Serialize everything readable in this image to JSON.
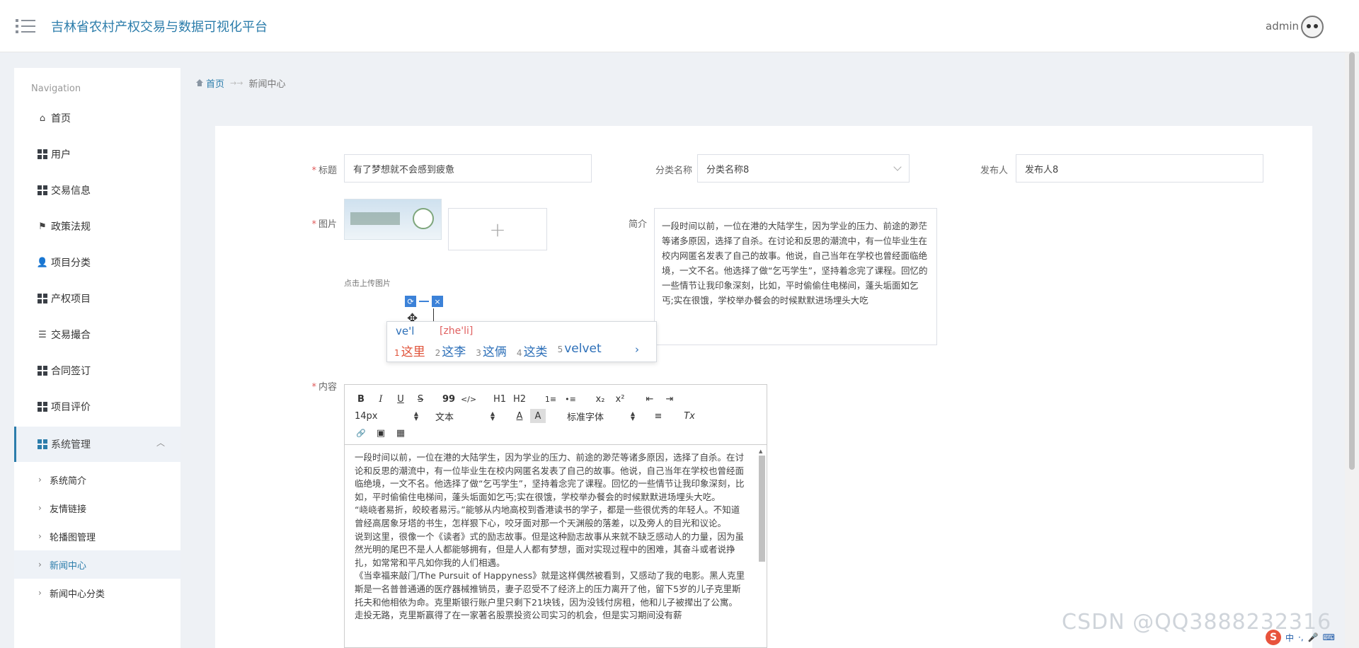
{
  "header": {
    "title": "吉林省农村产权交易与数据可视化平台",
    "user": "admin"
  },
  "sidebar": {
    "heading": "Navigation",
    "items": [
      {
        "label": "首页",
        "icon": "home-icon"
      },
      {
        "label": "用户",
        "icon": "grid-icon"
      },
      {
        "label": "交易信息",
        "icon": "grid-icon"
      },
      {
        "label": "政策法规",
        "icon": "flag-icon"
      },
      {
        "label": "项目分类",
        "icon": "user-icon"
      },
      {
        "label": "产权项目",
        "icon": "grid-icon"
      },
      {
        "label": "交易撮合",
        "icon": "list-icon"
      },
      {
        "label": "合同签订",
        "icon": "grid-icon"
      },
      {
        "label": "项目评价",
        "icon": "grid-icon"
      },
      {
        "label": "系统管理",
        "icon": "grid-icon"
      }
    ],
    "sub_items": [
      {
        "label": "系统简介"
      },
      {
        "label": "友情链接"
      },
      {
        "label": "轮播图管理"
      },
      {
        "label": "新闻中心"
      },
      {
        "label": "新闻中心分类"
      }
    ]
  },
  "breadcrumb": {
    "home": "首页",
    "separator": "→→",
    "current": "新闻中心"
  },
  "form": {
    "title_label": "标题",
    "title_value": "有了梦想就不会感到疲惫",
    "category_label": "分类名称",
    "category_value": "分类名称8",
    "publisher_label": "发布人",
    "publisher_value": "发布人8",
    "image_label": "图片",
    "upload_hint": "点击上传图片",
    "upload_plus": "+",
    "summary_label": "简介",
    "summary_value": "一段时间以前，一位在港的大陆学生，因为学业的压力、前途的渺茫等诸多原因，选择了自杀。在讨论和反思的潮流中，有一位毕业生在校内网匿名发表了自己的故事。他说，自己当年在学校也曾经面临绝境，一文不名。他选择了做“乞丐学生”，坚持着念完了课程。回忆的一些情节让我印象深刻，比如，平时偷偷住电梯间，蓬头垢面如乞丐;实在很饿，学校举办餐会的时候默默进场埋头大吃",
    "content_label": "内容"
  },
  "ime": {
    "refresh": "⟳",
    "close": "×",
    "input": "ve'l",
    "pinyin": "[zhe'li]",
    "candidates": [
      {
        "n": "1",
        "text": "这里"
      },
      {
        "n": "2",
        "text": "这李"
      },
      {
        "n": "3",
        "text": "这俩"
      },
      {
        "n": "4",
        "text": "这类"
      },
      {
        "n": "5",
        "text": "velvet"
      }
    ],
    "next": "›"
  },
  "editor": {
    "toolbar": {
      "bold": "B",
      "italic": "I",
      "underline": "U",
      "strike": "S",
      "quote": "99",
      "code": "</>",
      "h1": "H1",
      "h2": "H2",
      "ol": "1≡",
      "ul": "•≡",
      "sub": "x₂",
      "sup": "x²",
      "outdent": "⇤",
      "indent": "⇥",
      "size": "14px",
      "type": "文本",
      "font": "标准字体",
      "color": "A",
      "bg": "A",
      "align": "≡",
      "clean": "Tx",
      "link": "🔗",
      "image": "▣",
      "video": "▦"
    },
    "paragraphs": [
      "一段时间以前，一位在港的大陆学生，因为学业的压力、前途的渺茫等诸多原因，选择了自杀。在讨论和反思的潮流中，有一位毕业生在校内网匿名发表了自己的故事。他说，自己当年在学校也曾经面临绝境，一文不名。他选择了做“乞丐学生”，坚持着念完了课程。回忆的一些情节让我印象深刻，比如，平时偷偷住电梯间，蓬头垢面如乞丐;实在很饿，学校举办餐会的时候默默进场埋头大吃。",
      "“峣峣者易折，皎皎者易污。”能够从内地高校到香港读书的学子，都是一些很优秀的年轻人。不知道曾经高居象牙塔的书生，怎样狠下心，咬牙面对那一个天渊般的落差，以及旁人的目光和议论。",
      "说到这里，很像一个《读者》式的励志故事。但是这种励志故事从来就不缺乏感动人的力量，因为虽然光明的尾巴不是人人都能够拥有，但是人人都有梦想，面对实现过程中的困难，其奋斗或者说挣扎，如常常和平凡如你我的人们相遇。",
      "《当幸福来敲门/The Pursuit of Happyness》就是这样偶然被看到，又感动了我的电影。黑人克里斯是一名普普通通的医疗器械推销员，妻子忍受不了经济上的压力离开了他，留下5岁的儿子克里斯托夫和他相依为命。克里斯银行账户里只剩下21块钱，因为没钱付房租，他和儿子被撵出了公寓。走投无路，克里斯赢得了在一家著名股票投资公司实习的机会，但是实习期间没有薪"
    ]
  },
  "watermark": "CSDN @QQ3888232316",
  "tray": {
    "logo": "S",
    "lang": "中",
    "dots": "·,",
    "mic": "🎤",
    "kb": "⌨"
  }
}
